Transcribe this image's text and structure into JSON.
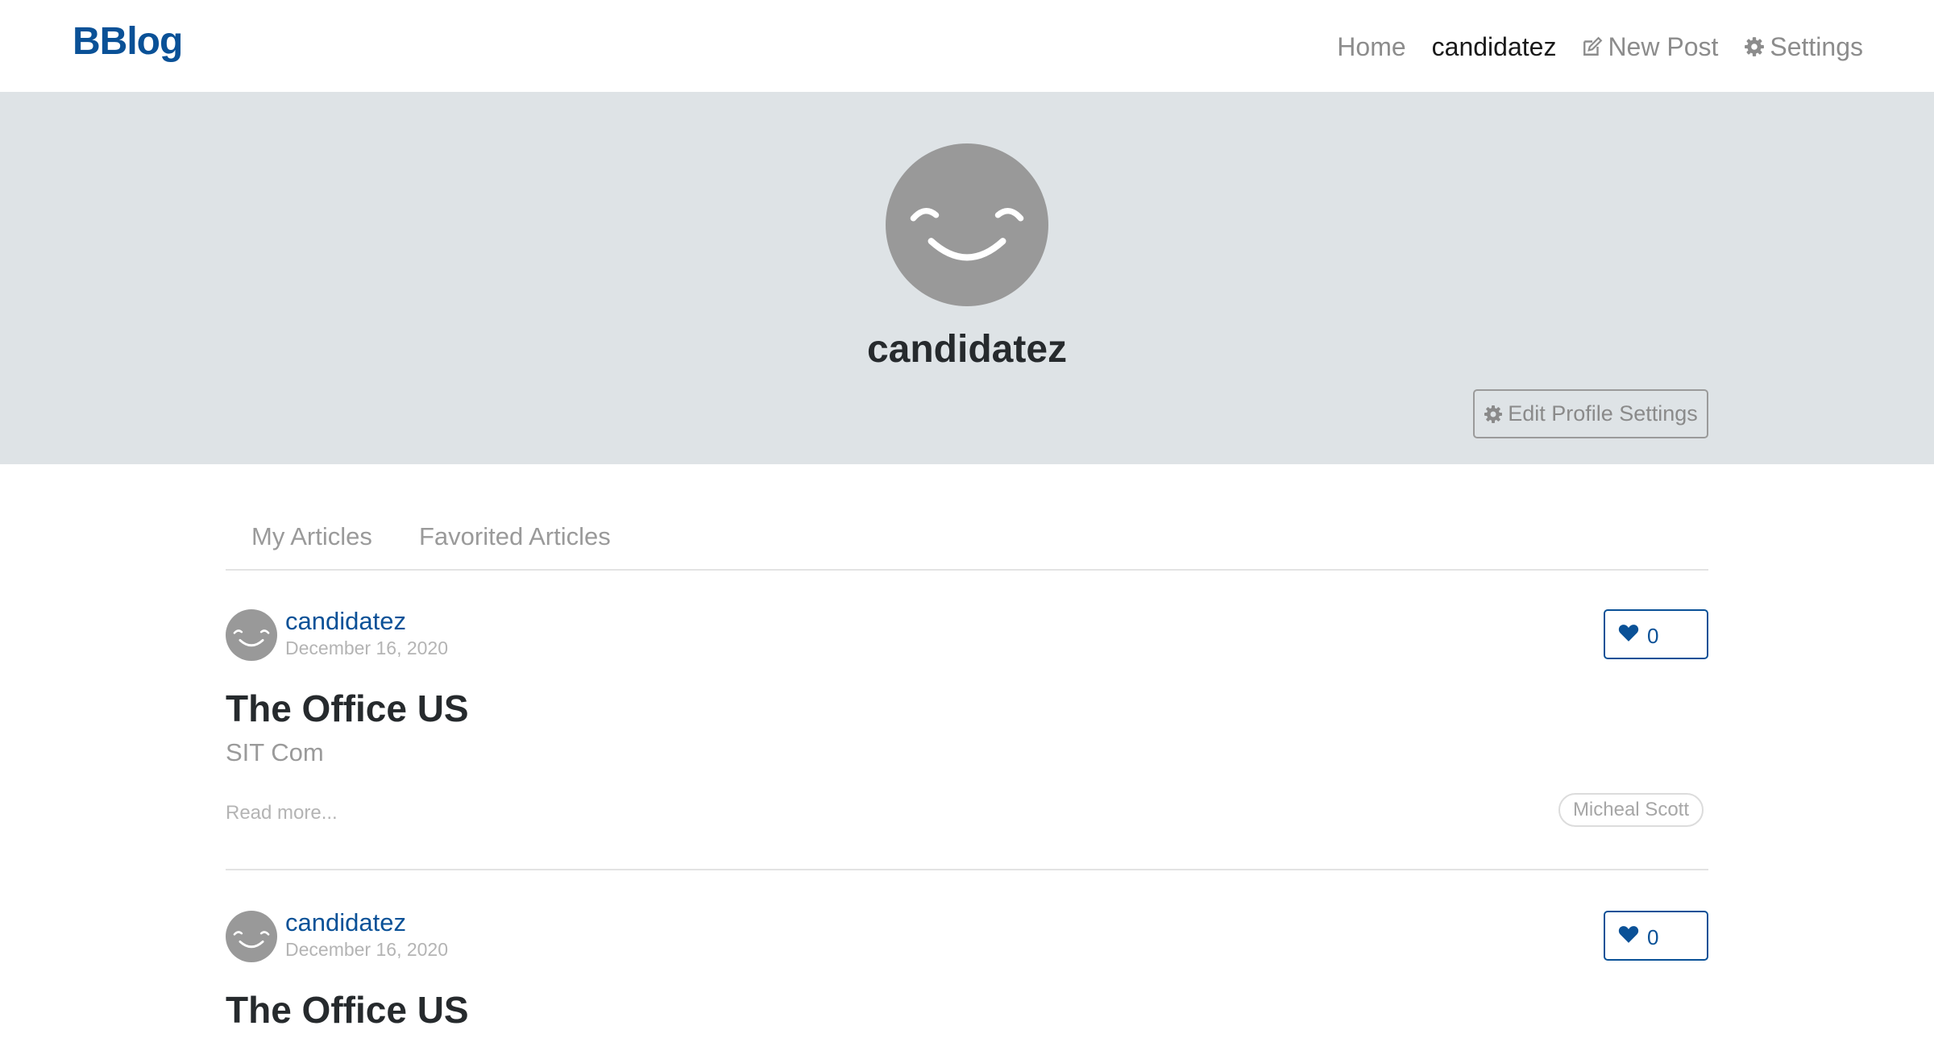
{
  "navbar": {
    "brand": "BBlog",
    "links": [
      {
        "label": "Home",
        "active": false
      },
      {
        "label": "candidatez",
        "active": true
      },
      {
        "label": "New Post",
        "icon": "edit-icon"
      },
      {
        "label": "Settings",
        "icon": "gear-icon"
      }
    ]
  },
  "profile": {
    "username": "candidatez",
    "avatar_icon": "smiley-face-icon",
    "edit_button_label": "Edit Profile Settings",
    "edit_button_icon": "gear-icon"
  },
  "tabs": [
    {
      "label": "My Articles"
    },
    {
      "label": "Favorited Articles"
    }
  ],
  "articles": [
    {
      "author": "candidatez",
      "date": "December 16, 2020",
      "favorites": "0",
      "title": "The Office US",
      "description": "SIT Com",
      "read_more": "Read more...",
      "tags": [
        "Micheal Scott"
      ]
    },
    {
      "author": "candidatez",
      "date": "December 16, 2020",
      "favorites": "0",
      "title": "The Office US"
    }
  ],
  "colors": {
    "brand": "#0a5197",
    "banner_bg": "#dee3e6",
    "avatar_gray": "#999999",
    "muted_text": "#9a9a9a"
  }
}
